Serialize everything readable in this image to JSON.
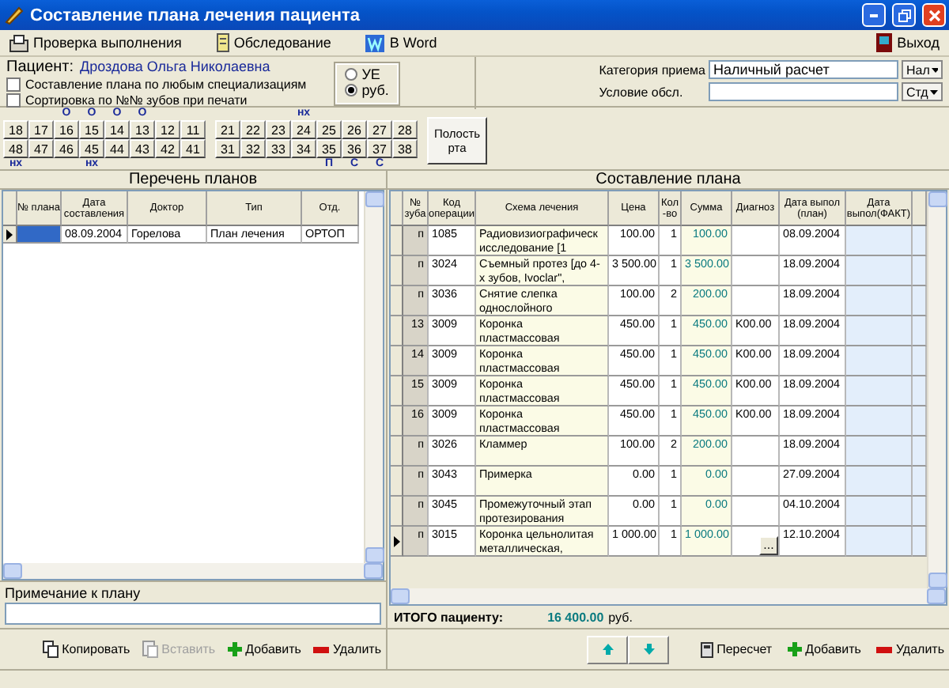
{
  "window": {
    "title": "Составление плана лечения пациента"
  },
  "toolbar": {
    "items": [
      {
        "label": "Проверка выполнения"
      },
      {
        "label": "Обследование"
      },
      {
        "label": "В Word"
      }
    ],
    "exit": "Выход"
  },
  "patient": {
    "label": "Пациент:",
    "name": "Дроздова Ольга Николаевна"
  },
  "options": [
    {
      "label": "Составление плана по любым специализациям",
      "checked": false
    },
    {
      "label": "Сортировка по №№ зубов при печати",
      "checked": false
    }
  ],
  "currency": [
    {
      "label": "УЕ",
      "selected": false
    },
    {
      "label": "руб.",
      "selected": true
    }
  ],
  "admission": {
    "category_label": "Категория приема",
    "category_value": "Наличный расчет",
    "category_button": "Нал",
    "condition_label": "Условие обсл.",
    "condition_button": "Стд"
  },
  "teeth": {
    "quadrants": [
      {
        "upper": [
          {
            "number": "18"
          },
          {
            "number": "17"
          },
          {
            "number": "16",
            "mark": "О"
          },
          {
            "number": "15",
            "mark": "О"
          },
          {
            "number": "14",
            "mark": "О"
          },
          {
            "number": "13",
            "mark": "О"
          },
          {
            "number": "12"
          },
          {
            "number": "11"
          }
        ],
        "lower": [
          {
            "number": "48",
            "mark": "нх"
          },
          {
            "number": "47"
          },
          {
            "number": "46"
          },
          {
            "number": "45",
            "mark": "нх"
          },
          {
            "number": "44"
          },
          {
            "number": "43"
          },
          {
            "number": "42"
          },
          {
            "number": "41"
          }
        ]
      },
      {
        "upper": [
          {
            "number": "21"
          },
          {
            "number": "22"
          },
          {
            "number": "23"
          },
          {
            "number": "24",
            "mark": "нх"
          },
          {
            "number": "25"
          },
          {
            "number": "26"
          },
          {
            "number": "27"
          },
          {
            "number": "28"
          }
        ],
        "lower": [
          {
            "number": "31"
          },
          {
            "number": "32"
          },
          {
            "number": "33"
          },
          {
            "number": "34"
          },
          {
            "number": "35",
            "mark": "П"
          },
          {
            "number": "36",
            "mark": "С"
          },
          {
            "number": "37",
            "mark": "С"
          },
          {
            "number": "38"
          }
        ]
      }
    ],
    "mouth_button": "Полость рта"
  },
  "plans": {
    "title": "Перечень планов",
    "columns": [
      "№ плана",
      "Дата составления",
      "Доктор",
      "Тип",
      "Отд."
    ],
    "rows": [
      {
        "date": "08.09.2004",
        "doctor": "Горелова",
        "type": "План лечения",
        "department": "ОРТОП",
        "selected": true
      }
    ],
    "note_label": "Примечание к плану",
    "buttons": [
      {
        "label": "Копировать",
        "disabled": false
      },
      {
        "label": "Вставить",
        "disabled": true
      },
      {
        "label": "Добавить",
        "disabled": false
      },
      {
        "label": "Удалить",
        "disabled": false
      }
    ]
  },
  "plan": {
    "title": "Составление плана",
    "columns": [
      "№ зуба",
      "Код операции",
      "Схема лечения",
      "Цена",
      "Кол-во",
      "Сумма",
      "Диагноз",
      "Дата выпол (план)",
      "Дата выпол(ФАКТ)"
    ],
    "rows": [
      {
        "tooth": "п",
        "code": "1085",
        "scheme": "Радиовизиографическ исследование [1",
        "price": "100.00",
        "qty": "1",
        "sum": "100.00",
        "plan_date": "08.09.2004",
        "current": false
      },
      {
        "tooth": "п",
        "code": "3024",
        "scheme": "Съемный протез [до 4-х зубов, Ivoclar\",",
        "price": "3 500.00",
        "qty": "1",
        "sum": "3 500.00",
        "plan_date": "18.09.2004",
        "current": false
      },
      {
        "tooth": "п",
        "code": "3036",
        "scheme": "Снятие слепка однослойного",
        "price": "100.00",
        "qty": "2",
        "sum": "200.00",
        "plan_date": "18.09.2004",
        "current": false
      },
      {
        "tooth": "13",
        "code": "3009",
        "scheme": "Коронка пластмассовая",
        "price": "450.00",
        "qty": "1",
        "sum": "450.00",
        "diagnosis": "K00.00",
        "plan_date": "18.09.2004",
        "current": false
      },
      {
        "tooth": "14",
        "code": "3009",
        "scheme": "Коронка пластмассовая",
        "price": "450.00",
        "qty": "1",
        "sum": "450.00",
        "diagnosis": "K00.00",
        "plan_date": "18.09.2004",
        "current": false
      },
      {
        "tooth": "15",
        "code": "3009",
        "scheme": "Коронка пластмассовая",
        "price": "450.00",
        "qty": "1",
        "sum": "450.00",
        "diagnosis": "K00.00",
        "plan_date": "18.09.2004",
        "current": false
      },
      {
        "tooth": "16",
        "code": "3009",
        "scheme": "Коронка пластмассовая",
        "price": "450.00",
        "qty": "1",
        "sum": "450.00",
        "diagnosis": "K00.00",
        "plan_date": "18.09.2004",
        "current": false
      },
      {
        "tooth": "п",
        "code": "3026",
        "scheme": "Кламмер",
        "price": "100.00",
        "qty": "2",
        "sum": "200.00",
        "plan_date": "18.09.2004",
        "current": false
      },
      {
        "tooth": "п",
        "code": "3043",
        "scheme": "Примерка",
        "price": "0.00",
        "qty": "1",
        "sum": "0.00",
        "plan_date": "27.09.2004",
        "current": false
      },
      {
        "tooth": "п",
        "code": "3045",
        "scheme": "Промежуточный этап протезирования",
        "price": "0.00",
        "qty": "1",
        "sum": "0.00",
        "plan_date": "04.10.2004",
        "current": false
      },
      {
        "tooth": "п",
        "code": "3015",
        "scheme": "Коронка цельнолитая металлическая,",
        "price": "1 000.00",
        "qty": "1",
        "sum": "1 000.00",
        "plan_date": "12.10.2004",
        "current": true,
        "edit_button": "..."
      }
    ],
    "total": {
      "label": "ИТОГО пациенту:",
      "value": "16 400.00",
      "currency": "руб."
    },
    "buttons": [
      {
        "label": "Пересчет",
        "disabled": false
      },
      {
        "label": "Добавить",
        "disabled": false
      },
      {
        "label": "Удалить",
        "disabled": false
      }
    ]
  }
}
